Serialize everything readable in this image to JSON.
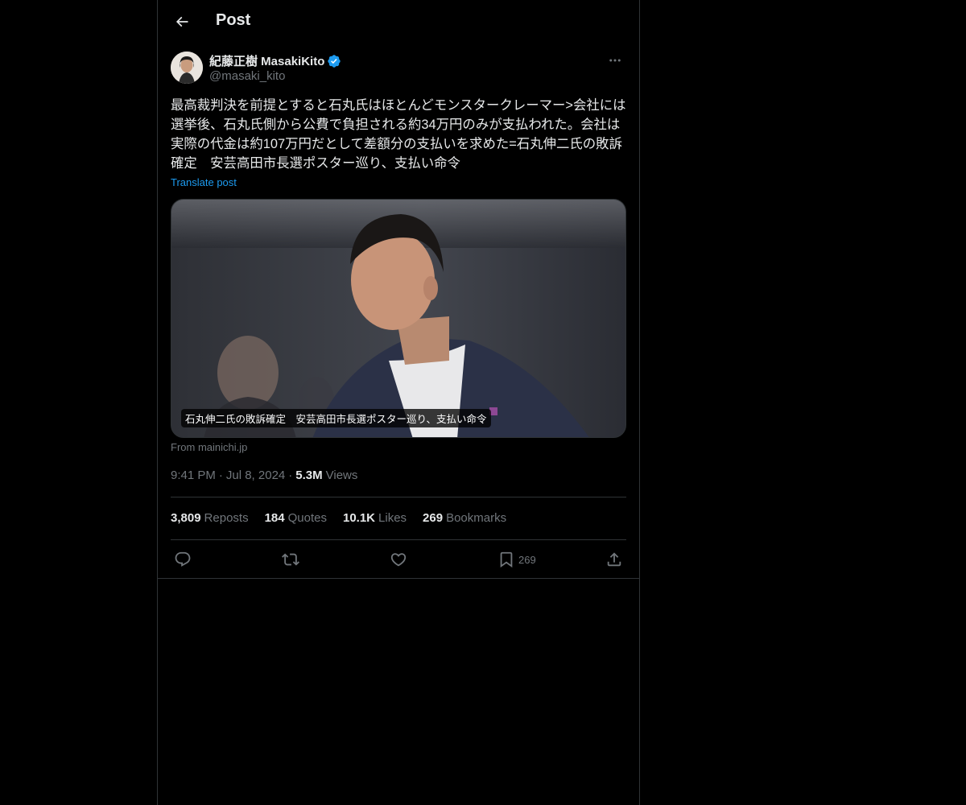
{
  "header": {
    "title": "Post"
  },
  "author": {
    "name": "紀藤正樹 MasakiKito",
    "handle": "@masaki_kito",
    "verified": true
  },
  "post": {
    "text": "最高裁判決を前提とすると石丸氏はほとんどモンスタークレーマー>会社には選挙後、石丸氏側から公費で負担される約34万円のみが支払われた。会社は実際の代金は約107万円だとして差額分の支払いを求めた=石丸伸二氏の敗訴確定　安芸高田市長選ポスター巡り、支払い命令",
    "translate_label": "Translate post"
  },
  "card": {
    "caption": "石丸伸二氏の敗訴確定　安芸高田市長選ポスター巡り、支払い命令",
    "source": "From mainichi.jp"
  },
  "meta": {
    "time": "9:41 PM",
    "sep1": "·",
    "date": "Jul 8, 2024",
    "sep2": "·",
    "views_count": "5.3M",
    "views_label": "Views"
  },
  "stats": [
    {
      "num": "3,809",
      "label": "Reposts"
    },
    {
      "num": "184",
      "label": "Quotes"
    },
    {
      "num": "10.1K",
      "label": "Likes"
    },
    {
      "num": "269",
      "label": "Bookmarks"
    }
  ],
  "actions": {
    "reply_icon": "reply-icon",
    "repost_icon": "repost-icon",
    "like_icon": "heart-icon",
    "bookmark_icon": "bookmark-icon",
    "bookmark_count": "269",
    "share_icon": "share-icon"
  },
  "colors": {
    "background": "#000000",
    "text": "#e7e9ea",
    "muted": "#71767b",
    "accent": "#1d9bf0",
    "border": "#2f3336"
  }
}
